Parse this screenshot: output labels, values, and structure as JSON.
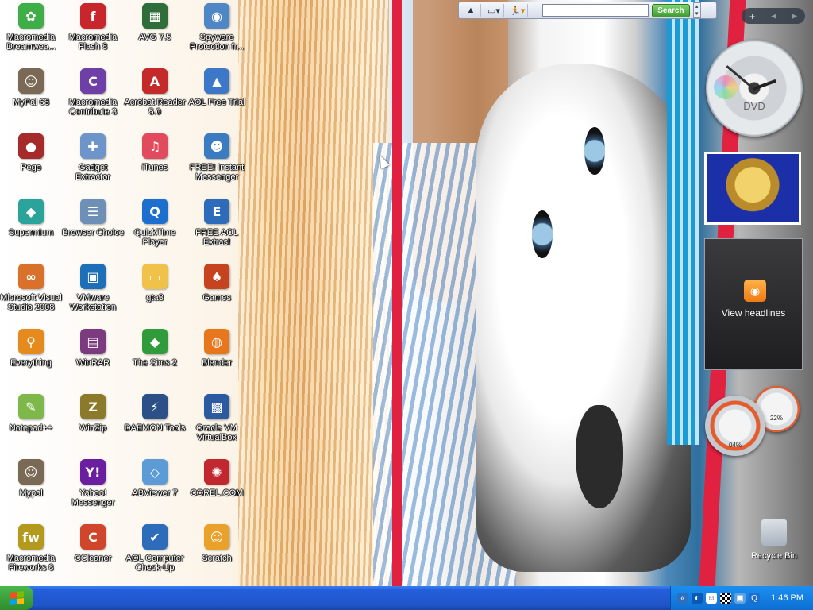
{
  "desktop": {
    "icons": [
      {
        "label": "Macromedia Dreamwea...",
        "icon": "dreamweaver-icon",
        "color": "#3fae49",
        "glyph": "✿"
      },
      {
        "label": "Macromedia Flash 8",
        "icon": "flash-icon",
        "color": "#c8252d",
        "glyph": "f"
      },
      {
        "label": "AVG 7.5",
        "icon": "avg-icon",
        "color": "#2f6d3a",
        "glyph": "▦"
      },
      {
        "label": "Spyware Protection fr...",
        "icon": "spyware-protection-icon",
        "color": "#4e86c6",
        "glyph": "◉"
      },
      {
        "label": "MyPal 68",
        "icon": "mypal-icon",
        "color": "#7a6a55",
        "glyph": "☺"
      },
      {
        "label": "Macromedia Contribute 3",
        "icon": "contribute-icon",
        "color": "#6f3fa8",
        "glyph": "C"
      },
      {
        "label": "Acrobat Reader 5.0",
        "icon": "acrobat-icon",
        "color": "#c42a2a",
        "glyph": "A"
      },
      {
        "label": "AOL Free Trial",
        "icon": "aol-icon",
        "color": "#3d78c8",
        "glyph": "▲"
      },
      {
        "label": "Pego",
        "icon": "pego-icon",
        "color": "#a52a2a",
        "glyph": "●"
      },
      {
        "label": "Gadget Extractor",
        "icon": "gadget-extractor-icon",
        "color": "#6e95c9",
        "glyph": "✚"
      },
      {
        "label": "iTunes",
        "icon": "itunes-icon",
        "color": "#e24b5d",
        "glyph": "♫"
      },
      {
        "label": "FREE! Instant Messenger",
        "icon": "instant-messenger-icon",
        "color": "#3a7bc1",
        "glyph": "☻"
      },
      {
        "label": "Supermium",
        "icon": "supermium-icon",
        "color": "#2aa39a",
        "glyph": "◆"
      },
      {
        "label": "Browser Choice",
        "icon": "browser-choice-icon",
        "color": "#6e8fb6",
        "glyph": "☰"
      },
      {
        "label": "QuickTime Player",
        "icon": "quicktime-icon",
        "color": "#1c6fcf",
        "glyph": "Q"
      },
      {
        "label": "FREE AOL Extras!",
        "icon": "aol-extras-icon",
        "color": "#2d6cba",
        "glyph": "E"
      },
      {
        "label": "Microsoft Visual Studio 2008",
        "icon": "visual-studio-icon",
        "color": "#d9712b",
        "glyph": "∞"
      },
      {
        "label": "VMware Workstation",
        "icon": "vmware-icon",
        "color": "#1d6fb8",
        "glyph": "▣"
      },
      {
        "label": "gta3",
        "icon": "folder-icon",
        "color": "#f0c24a",
        "glyph": "▭"
      },
      {
        "label": "Games",
        "icon": "games-icon",
        "color": "#c7421f",
        "glyph": "♠"
      },
      {
        "label": "Everything",
        "icon": "everything-icon",
        "color": "#e58a1c",
        "glyph": "⚲"
      },
      {
        "label": "WinRAR",
        "icon": "winrar-icon",
        "color": "#7c3b7f",
        "glyph": "▤"
      },
      {
        "label": "The Sims 2",
        "icon": "sims-icon",
        "color": "#2f9b3a",
        "glyph": "◆"
      },
      {
        "label": "Blender",
        "icon": "blender-icon",
        "color": "#e8761c",
        "glyph": "◍"
      },
      {
        "label": "Notepad++",
        "icon": "notepadpp-icon",
        "color": "#7fb84a",
        "glyph": "✎"
      },
      {
        "label": "WinZip",
        "icon": "winzip-icon",
        "color": "#8a7a2a",
        "glyph": "Z"
      },
      {
        "label": "DAEMON Tools",
        "icon": "daemon-tools-icon",
        "color": "#2b4f86",
        "glyph": "⚡"
      },
      {
        "label": "Oracle VM VirtualBox",
        "icon": "virtualbox-icon",
        "color": "#2c5aa0",
        "glyph": "▩"
      },
      {
        "label": "Mypal",
        "icon": "mypal-icon",
        "color": "#7a6a55",
        "glyph": "☺"
      },
      {
        "label": "Yahoo! Messenger",
        "icon": "yahoo-messenger-icon",
        "color": "#6a1fa0",
        "glyph": "Y!"
      },
      {
        "label": "ABViewer 7",
        "icon": "abviewer-icon",
        "color": "#5c9bd6",
        "glyph": "◇"
      },
      {
        "label": "COREL.COM",
        "icon": "corel-icon",
        "color": "#c2262e",
        "glyph": "✺"
      },
      {
        "label": "Macromedia Fireworks 8",
        "icon": "fireworks-icon",
        "color": "#b39a1c",
        "glyph": "fw"
      },
      {
        "label": "CCleaner",
        "icon": "ccleaner-icon",
        "color": "#d1462a",
        "glyph": "C"
      },
      {
        "label": "AOL Computer Check-Up",
        "icon": "aol-checkup-icon",
        "color": "#2d6cba",
        "glyph": "✔"
      },
      {
        "label": "Scratch",
        "icon": "scratch-icon",
        "color": "#e9a12a",
        "glyph": "☺"
      }
    ],
    "recycle_bin_label": "Recycle Bin"
  },
  "toolbar": {
    "search_button": "Search",
    "search_value": ""
  },
  "sidebar": {
    "add_symbol": "+",
    "prev_symbol": "◂",
    "next_symbol": "▸",
    "clock_label": "DVD",
    "feed_label": "View headlines",
    "cpu_meter_value": "04%",
    "memory_meter_value": "22%"
  },
  "taskbar": {
    "time": "1:46 PM"
  },
  "colors": {
    "taskbar": "#245edb",
    "start_button": "#3c9b3c",
    "tray": "#0f6fd3"
  }
}
